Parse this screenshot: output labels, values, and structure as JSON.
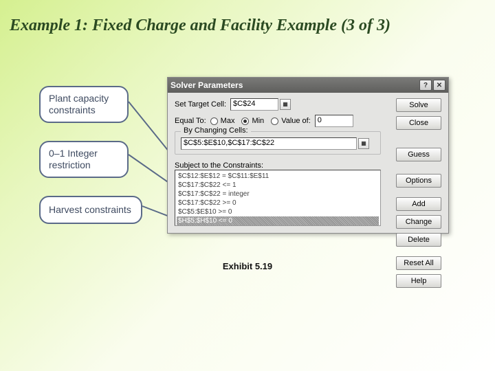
{
  "slide": {
    "title": "Example 1: Fixed Charge and Facility Example (3 of 3)",
    "exhibit": "Exhibit 5.19"
  },
  "callouts": {
    "plant": "Plant capacity constraints",
    "integer": "0–1 Integer restriction",
    "harvest": "Harvest constraints"
  },
  "dialog": {
    "title": "Solver Parameters",
    "target_label": "Set Target Cell:",
    "target_value": "$C$24",
    "equal_label": "Equal To:",
    "option_max": "Max",
    "option_min": "Min",
    "option_valueof": "Value of:",
    "valueof_value": "0",
    "changing_group": "By Changing Cells:",
    "changing_value": "$C$5:$E$10,$C$17:$C$22",
    "constraints_label": "Subject to the Constraints:",
    "constraints": [
      "$C$12:$E$12 = $C$11:$E$11",
      "$C$17:$C$22 <= 1",
      "$C$17:$C$22 = integer",
      "$C$17:$C$22 >= 0",
      "$C$5:$E$10 >= 0",
      "$H$5:$H$10 <= 0"
    ],
    "buttons": {
      "solve": "Solve",
      "close": "Close",
      "guess": "Guess",
      "options": "Options",
      "add": "Add",
      "change": "Change",
      "delete": "Delete",
      "resetall": "Reset All",
      "help": "Help"
    }
  }
}
